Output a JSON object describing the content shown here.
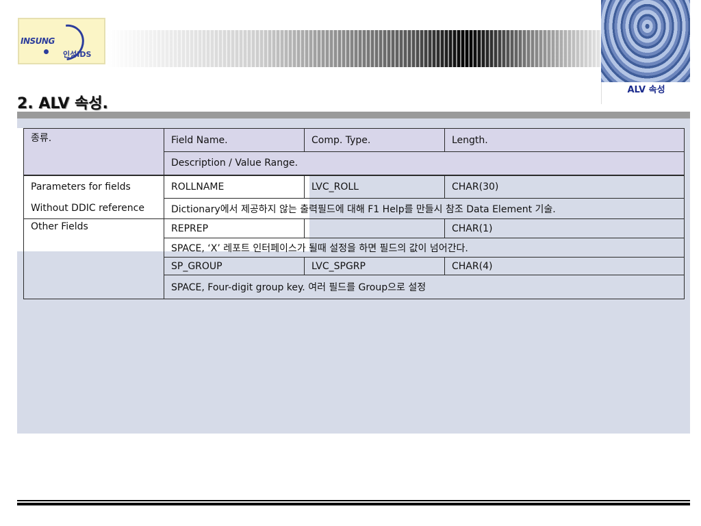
{
  "logo": {
    "main": "INSUNG",
    "sub": "인성IDS"
  },
  "corner_label": "ALV 속성",
  "page_title": "2. ALV 속성.",
  "table": {
    "header": {
      "kind": "종류.",
      "field_name": "Field Name.",
      "comp_type": "Comp. Type.",
      "length": "Length.",
      "description": "Description / Value Range."
    },
    "label_lines": [
      "Parameters for fields",
      "Without DDIC reference",
      "Other Fields"
    ],
    "rows": [
      {
        "field": "ROLLNAME",
        "type": "LVC_ROLL",
        "length": "CHAR(30)",
        "desc": "Dictionary에서 제공하지 않는 출력필드에 대해 F1 Help를 만들시 참조 Data Element 기술."
      },
      {
        "field": "REPREP",
        "type": "",
        "length": "CHAR(1)",
        "desc": "SPACE, ‘X’  레포트 인터페이스가 될때 설정을 하면 필드의 값이 넘어간다."
      },
      {
        "field": "SP_GROUP",
        "type": "LVC_SPGRP",
        "length": "CHAR(4)",
        "desc": "SPACE, Four-digit group key. 여러 필드를 Group으로 설정"
      }
    ]
  },
  "colors": {
    "panel": "#d6dbe8",
    "header_fill": "#d8d6ea",
    "corner_text": "#1a2a8c",
    "title_rule": "#9a9a9a"
  }
}
